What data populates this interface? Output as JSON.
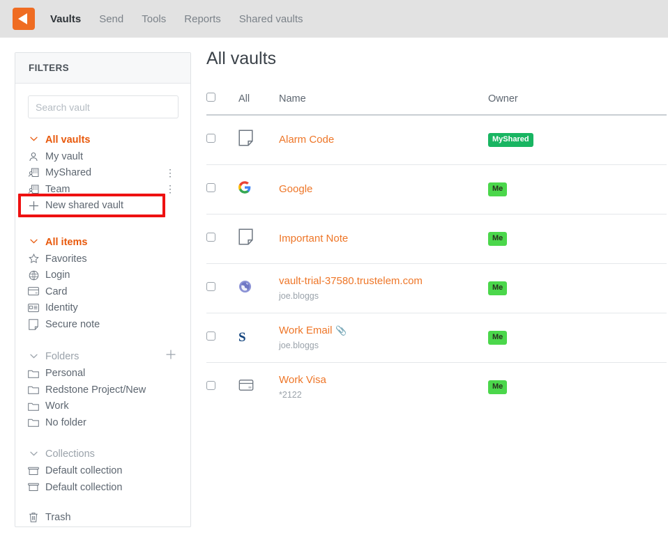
{
  "app": {
    "logo_icon": "dashlane-logo-icon",
    "nav": [
      {
        "label": "Vaults",
        "active": true
      },
      {
        "label": "Send",
        "active": false
      },
      {
        "label": "Tools",
        "active": false
      },
      {
        "label": "Reports",
        "active": false
      },
      {
        "label": "Shared vaults",
        "active": false
      }
    ]
  },
  "sidebar": {
    "header": "FILTERS",
    "search": {
      "placeholder": "Search vault",
      "value": ""
    },
    "vaults_group": {
      "label": "All vaults",
      "chevron_icon": "chevron-down-icon",
      "items": [
        {
          "label": "My vault",
          "icon": "person-icon",
          "menu": false
        },
        {
          "label": "MyShared",
          "icon": "shared-vault-icon",
          "menu": true
        },
        {
          "label": "Team",
          "icon": "shared-vault-icon",
          "menu": true
        },
        {
          "label": "New shared vault",
          "icon": "plus-icon",
          "menu": false
        }
      ]
    },
    "items_group": {
      "label": "All items",
      "chevron_icon": "chevron-down-icon",
      "items": [
        {
          "label": "Favorites",
          "icon": "star-icon"
        },
        {
          "label": "Login",
          "icon": "globe-icon"
        },
        {
          "label": "Card",
          "icon": "credit-card-icon"
        },
        {
          "label": "Identity",
          "icon": "id-card-icon"
        },
        {
          "label": "Secure note",
          "icon": "note-icon"
        }
      ]
    },
    "folders_group": {
      "label": "Folders",
      "chevron_icon": "chevron-down-icon",
      "add_icon": "plus-icon",
      "items": [
        {
          "label": "Personal",
          "icon": "folder-icon"
        },
        {
          "label": "Redstone Project/New",
          "icon": "folder-icon"
        },
        {
          "label": "Work",
          "icon": "folder-icon"
        },
        {
          "label": "No folder",
          "icon": "folder-icon"
        }
      ]
    },
    "collections_group": {
      "label": "Collections",
      "chevron_icon": "chevron-down-icon",
      "items": [
        {
          "label": "Default collection",
          "icon": "collection-icon"
        },
        {
          "label": "Default collection",
          "icon": "collection-icon"
        }
      ]
    },
    "trash": {
      "label": "Trash",
      "icon": "trash-icon"
    },
    "menu_dots_icon": "kebab-menu-icon"
  },
  "annotation": {
    "highlight_color": "#ee1111",
    "target_label": "New shared vault"
  },
  "main": {
    "title": "All vaults",
    "columns": {
      "select_all": "All",
      "name": "Name",
      "owner": "Owner"
    },
    "rows": [
      {
        "name": "Alarm Code",
        "sub": "",
        "icon": "note-icon",
        "owner": "MyShared",
        "owner_type": "shared",
        "attachment": false,
        "checked": false
      },
      {
        "name": "Google",
        "sub": "",
        "icon": "google-icon",
        "owner": "Me",
        "owner_type": "me",
        "attachment": false,
        "checked": false
      },
      {
        "name": "Important Note",
        "sub": "",
        "icon": "note-icon",
        "owner": "Me",
        "owner_type": "me",
        "attachment": false,
        "checked": false
      },
      {
        "name": "vault-trial-37580.trustelem.com",
        "sub": "joe.bloggs",
        "icon": "globe-favicon",
        "owner": "Me",
        "owner_type": "me",
        "attachment": false,
        "checked": false
      },
      {
        "name": "Work Email",
        "sub": "joe.bloggs",
        "icon": "salesforce-s-icon",
        "owner": "Me",
        "owner_type": "me",
        "attachment": true,
        "attachment_icon": "paperclip-icon",
        "checked": false
      },
      {
        "name": "Work Visa",
        "sub": "*2122",
        "icon": "credit-card-icon",
        "owner": "Me",
        "owner_type": "me",
        "attachment": false,
        "checked": false
      }
    ]
  },
  "colors": {
    "accent_orange": "#ee7628",
    "brand_orange": "#ef6c22",
    "badge_shared_green": "#19b562",
    "badge_me_green": "#4bd74b",
    "highlight_red": "#ee1111"
  }
}
